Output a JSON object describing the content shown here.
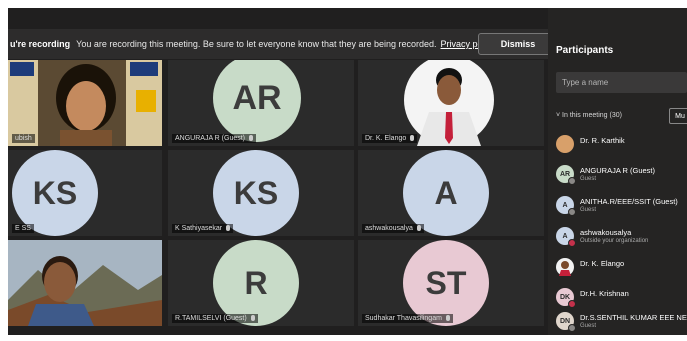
{
  "recording_banner": {
    "title": "u're recording",
    "message": "You are recording this meeting. Be sure to let everyone know that they are being recorded.",
    "link": "Privacy policy",
    "dismiss_label": "Dismiss"
  },
  "tiles": [
    {
      "name": "ubish",
      "initials": "",
      "kind": "video-woman"
    },
    {
      "name": "ANGURAJA R (Guest)",
      "initials": "AR",
      "color": "#c8dbc8"
    },
    {
      "name": "Dr. K. Elango",
      "initials": "",
      "kind": "photo-man"
    },
    {
      "name": "E SS",
      "initials": "KS",
      "color": "#c9d6e8"
    },
    {
      "name": "K Sathiyasekar",
      "initials": "KS",
      "color": "#c9d6e8"
    },
    {
      "name": "ashwakousalya",
      "initials": "A",
      "color": "#c9d6e8"
    },
    {
      "name": "",
      "initials": "",
      "kind": "video-man"
    },
    {
      "name": "R.TAMILSELVI (Guest)",
      "initials": "R",
      "color": "#c8dbc8"
    },
    {
      "name": "Sudhakar Thavasilingam",
      "initials": "ST",
      "color": "#e8c9d3"
    }
  ],
  "panel": {
    "title": "Participants",
    "search_placeholder": "Type a name",
    "in_meeting": "In this meeting (30)",
    "mute_label": "Mu",
    "participants": [
      {
        "name": "Dr. R. Karthik",
        "sub": "",
        "initials": "",
        "color": "#d8a06a",
        "status": "none"
      },
      {
        "name": "ANGURAJA R (Guest)",
        "sub": "Guest",
        "initials": "AR",
        "color": "#c8dbc8",
        "status": "gray"
      },
      {
        "name": "ANITHA.R/EEE/SSIT (Guest)",
        "sub": "Guest",
        "initials": "A",
        "color": "#c9d6e8",
        "status": "gray"
      },
      {
        "name": "ashwakousalya",
        "sub": "Outside your organization",
        "initials": "A",
        "color": "#c9d6e8",
        "status": "red"
      },
      {
        "name": "Dr. K. Elango",
        "sub": "",
        "initials": "",
        "color": "#b48a6c",
        "status": "none"
      },
      {
        "name": "Dr.H. Krishnan",
        "sub": "",
        "initials": "DK",
        "color": "#e8c9d3",
        "status": "red"
      },
      {
        "name": "Dr.S.SENTHIL KUMAR EEE NE",
        "sub": "Guest",
        "initials": "DN",
        "color": "#e0d6cc",
        "status": "gray"
      }
    ]
  },
  "colors": {
    "background": "#201f1f",
    "panel": "#252423",
    "accent": "#6264a7"
  }
}
